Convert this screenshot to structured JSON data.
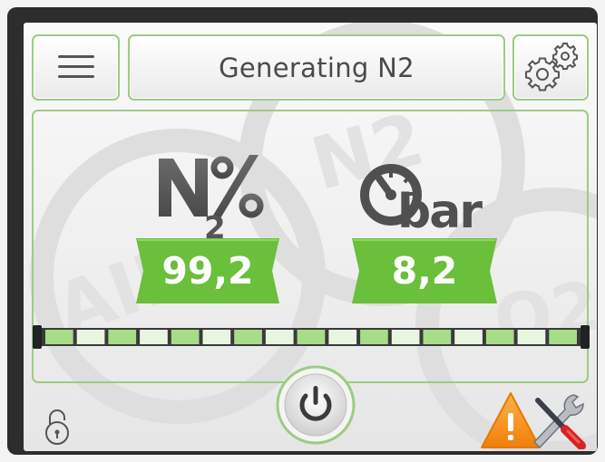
{
  "header": {
    "title": "Generating N2",
    "menu_icon": "hamburger-menu-icon",
    "settings_icon": "gears-icon"
  },
  "measurements": {
    "nitrogen": {
      "icon": "n2-percent-icon",
      "value": "99,2"
    },
    "pressure": {
      "icon": "pressure-gauge-bar-icon",
      "value": "8,2"
    }
  },
  "progress": {
    "segments": 17
  },
  "footer": {
    "lock_icon": "padlock-icon",
    "power_icon": "power-icon",
    "warning_icon": "warning-maintenance-icon"
  },
  "colors": {
    "accent_green": "#6abf3b",
    "border_green": "#9ccc83",
    "warning_orange": "#f7941d",
    "frame": "#2d2d2d"
  }
}
